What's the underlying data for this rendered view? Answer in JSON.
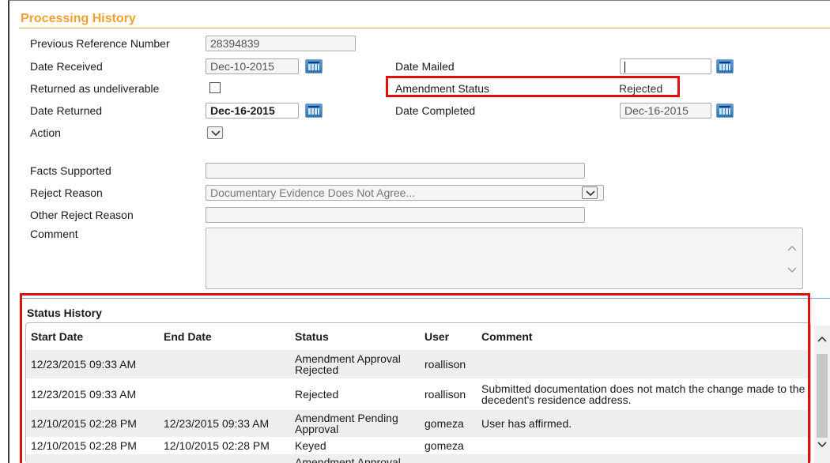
{
  "panel": {
    "title": "Processing History"
  },
  "fields": {
    "previous_reference_number": {
      "label": "Previous Reference Number",
      "value": "28394839"
    },
    "date_received": {
      "label": "Date Received",
      "value": "Dec-10-2015"
    },
    "date_mailed": {
      "label": "Date Mailed",
      "value": ""
    },
    "returned_as_undeliverable": {
      "label": "Returned as undeliverable",
      "checked": false
    },
    "amendment_status": {
      "label": "Amendment Status",
      "value": "Rejected"
    },
    "date_returned": {
      "label": "Date Returned",
      "value": "Dec-16-2015"
    },
    "date_completed": {
      "label": "Date Completed",
      "value": "Dec-16-2015"
    },
    "action": {
      "label": "Action",
      "value": ""
    },
    "facts_supported": {
      "label": "Facts Supported",
      "value": ""
    },
    "reject_reason": {
      "label": "Reject Reason",
      "value": "Documentary Evidence Does Not Agree..."
    },
    "other_reject_reason": {
      "label": "Other Reject Reason",
      "value": ""
    },
    "comment": {
      "label": "Comment",
      "value": ""
    }
  },
  "status_history": {
    "title": "Status History",
    "columns": [
      "Start Date",
      "End Date",
      "Status",
      "User",
      "Comment"
    ],
    "rows": [
      {
        "start": "12/23/2015 09:33 AM",
        "end": "",
        "status": "Amendment Approval Rejected",
        "user": "roallison",
        "comment": ""
      },
      {
        "start": "12/23/2015 09:33 AM",
        "end": "",
        "status": "Rejected",
        "user": "roallison",
        "comment": "Submitted documentation does not match the change made to the decedent's residence address."
      },
      {
        "start": "12/10/2015 02:28 PM",
        "end": "12/23/2015 09:33 AM",
        "status": "Amendment Pending Approval",
        "user": "gomeza",
        "comment": "User has affirmed."
      },
      {
        "start": "12/10/2015 02:28 PM",
        "end": "12/10/2015 02:28 PM",
        "status": "Keyed",
        "user": "gomeza",
        "comment": ""
      },
      {
        "start": "",
        "end": "",
        "status": "Amendment Approval",
        "user": "",
        "comment": ""
      }
    ]
  },
  "icons": {
    "calendar": "calendar-icon",
    "dropdown": "chevron-down-icon",
    "scroll_up": "chevron-up-icon",
    "scroll_down": "chevron-down-icon"
  },
  "colors": {
    "title": "#f0a030",
    "highlight_box": "#e01010",
    "row_alt": "#eeeeee"
  }
}
